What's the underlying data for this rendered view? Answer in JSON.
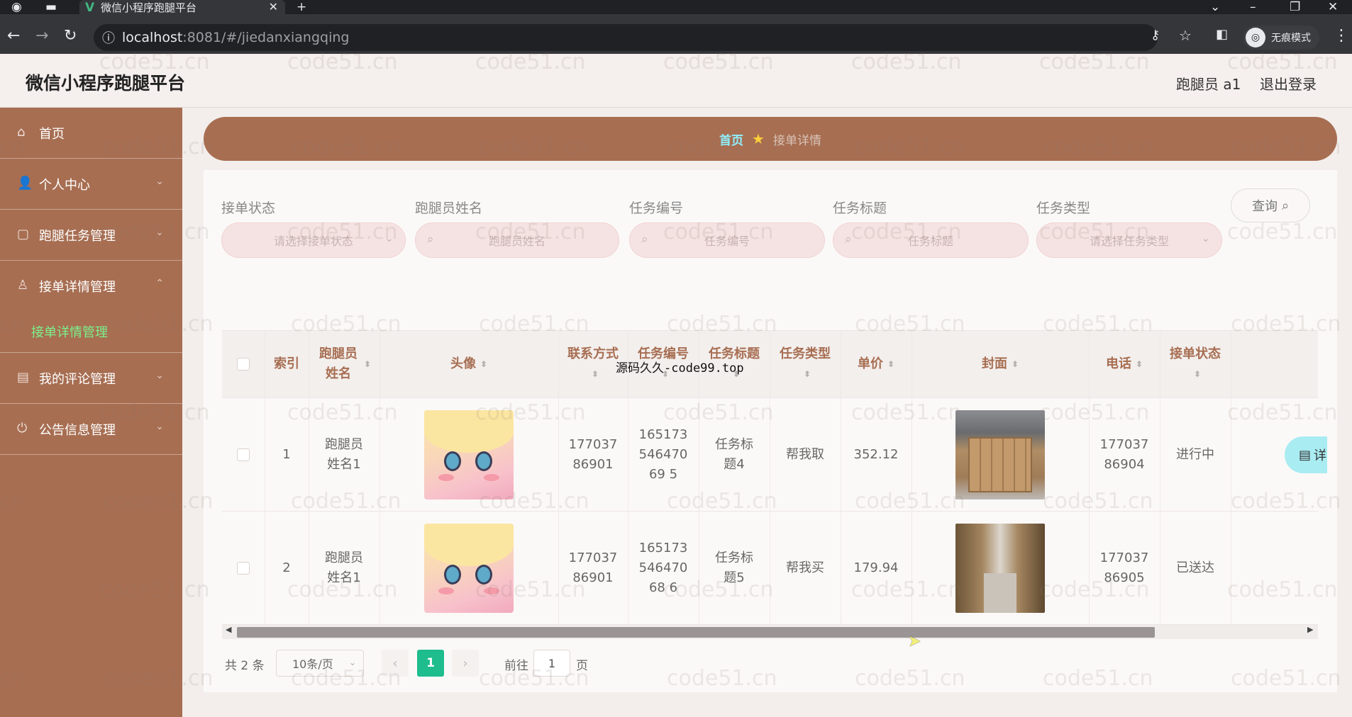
{
  "browser": {
    "tab_title": "微信小程序跑腿平台",
    "tab_close": "✕",
    "new_tab": "+",
    "url_host": "localhost",
    "url_path": ":8081/#/jiedanxiangqing",
    "incognito_label": "无痕模式"
  },
  "header": {
    "title": "微信小程序跑腿平台",
    "user": "跑腿员 a1",
    "logout": "退出登录"
  },
  "sidebar": {
    "items": [
      {
        "label": "首页",
        "icon": "home-icon"
      },
      {
        "label": "个人中心",
        "icon": "user-icon"
      },
      {
        "label": "跑腿任务管理",
        "icon": "task-icon"
      },
      {
        "label": "接单详情管理",
        "icon": "order-icon"
      },
      {
        "label": "我的评论管理",
        "icon": "comment-icon"
      },
      {
        "label": "公告信息管理",
        "icon": "notice-icon"
      }
    ],
    "active_sub": "接单详情管理"
  },
  "breadcrumb": {
    "home": "首页",
    "current": "接单详情"
  },
  "filters": {
    "status_label": "接单状态",
    "status_placeholder": "请选择接单状态",
    "name_label": "跑腿员姓名",
    "name_placeholder": "跑腿员姓名",
    "taskno_label": "任务编号",
    "taskno_placeholder": "任务编号",
    "tasktitle_label": "任务标题",
    "tasktitle_placeholder": "任务标题",
    "tasktype_label": "任务类型",
    "tasktype_placeholder": "请选择任务类型",
    "query_button": "查询"
  },
  "table": {
    "headers": {
      "index": "索引",
      "name": "跑腿员姓名",
      "avatar": "头像",
      "contact": "联系方式",
      "taskno": "任务编号",
      "tasktitle": "任务标题",
      "tasktype": "任务类型",
      "price": "单价",
      "cover": "封面",
      "phone": "电话",
      "status": "接单状态"
    },
    "rows": [
      {
        "index": "1",
        "name": "跑腿员姓名1",
        "contact": "17703786901",
        "taskno": "16517354647069 5",
        "tasktitle": "任务标题4",
        "tasktype": "帮我取",
        "price": "352.12",
        "phone": "17703786904",
        "status": "进行中",
        "action": "详"
      },
      {
        "index": "2",
        "name": "跑腿员姓名1",
        "contact": "17703786901",
        "taskno": "16517354647068 6",
        "tasktitle": "任务标题5",
        "tasktype": "帮我买",
        "price": "179.94",
        "phone": "17703786905",
        "status": "已送达"
      }
    ]
  },
  "pagination": {
    "total": "共 2 条",
    "page_size": "10条/页",
    "current_page": "1",
    "goto_label": "前往",
    "goto_value": "1",
    "page_suffix": "页"
  },
  "overlay_text": "源码久久-code99.top",
  "watermark": "code51.cn"
}
